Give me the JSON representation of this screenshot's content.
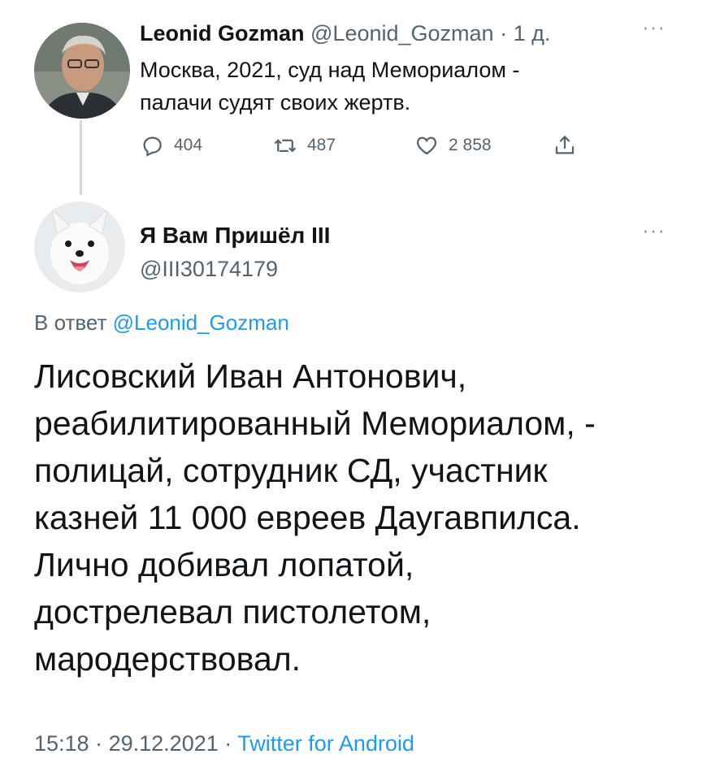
{
  "parent_tweet": {
    "author_name": "Leonid Gozman",
    "handle": "@Leonid_Gozman",
    "separator": "·",
    "time_ago": "1 д.",
    "more_label": "···",
    "text_lines": [
      "Москва, 2021, суд над Мемориалом -",
      "палачи судят своих жертв."
    ],
    "actions": {
      "reply_icon": "reply-icon",
      "reply_count": "404",
      "retweet_icon": "retweet-icon",
      "retweet_count": "487",
      "like_icon": "heart-icon",
      "like_count": "2 858",
      "share_icon": "share-icon"
    }
  },
  "reply_tweet": {
    "author_name": "Я Вам Пришёл III",
    "handle": "@III30174179",
    "more_label": "···",
    "in_reply_prefix": "В ответ",
    "in_reply_mention": "@Leonid_Gozman",
    "text_lines": [
      "Лисовский Иван Антонович,",
      "реабилитированный Мемориалом, -",
      "полицай, сотрудник СД, участник",
      "казней 11 000 евреев Даугавпилса.",
      "Лично добивал лопатой,",
      "дострелевал пистолетом,",
      "мародерствовал."
    ],
    "time": "15:18",
    "separator": "·",
    "date": "29.12.2021",
    "client": "Twitter for Android"
  },
  "colors": {
    "text": "#0f1419",
    "secondary": "#536471",
    "link": "#1d9bf0",
    "thread_line": "#cfd9de"
  }
}
